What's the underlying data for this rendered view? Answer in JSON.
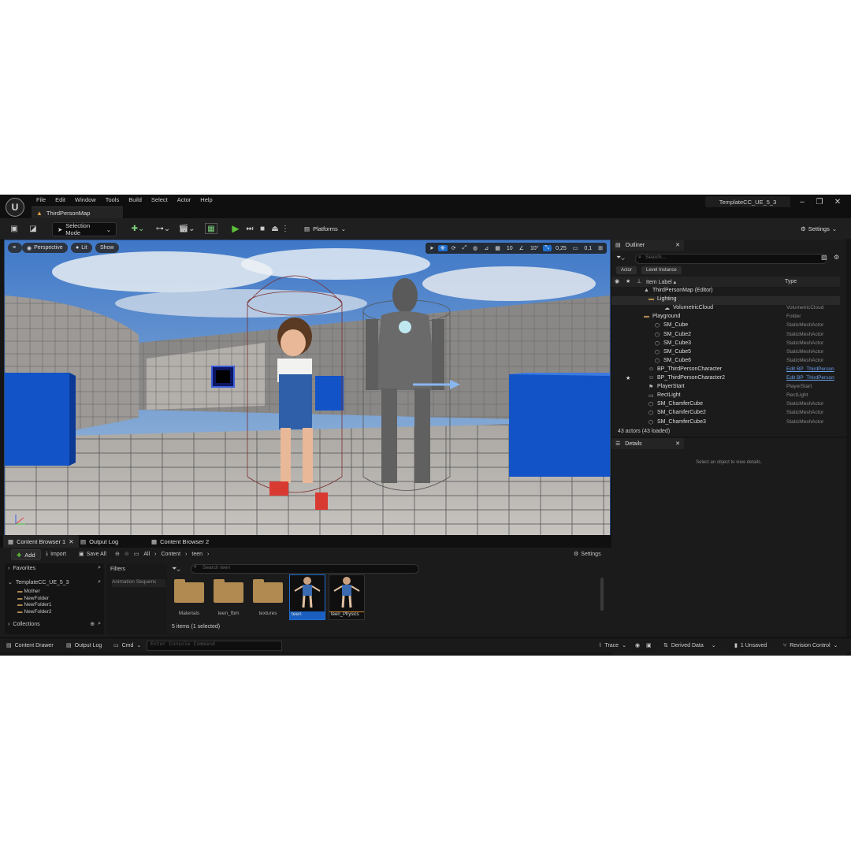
{
  "app": {
    "menus": [
      "File",
      "Edit",
      "Window",
      "Tools",
      "Build",
      "Select",
      "Actor",
      "Help"
    ],
    "map_tab": "ThirdPersonMap",
    "project": "TemplateCC_UE_5_3"
  },
  "toolbar": {
    "selection_mode": "Selection Mode",
    "platforms": "Platforms",
    "settings": "Settings"
  },
  "viewport": {
    "perspective": "Perspective",
    "lit": "Lit",
    "show": "Show",
    "grid_snap": "10",
    "rot_snap": "10°",
    "scale_snap": "0,25",
    "cam_speed": "0,1"
  },
  "outliner": {
    "tab": "Outliner",
    "search_placeholder": "Search...",
    "chips": [
      "Actor",
      "Level Instance"
    ],
    "col_label": "Item Label ▴",
    "col_type": "Type",
    "rows": [
      {
        "label": "ThirdPersonMap (Editor)",
        "type": ""
      },
      {
        "label": "Lighting",
        "type": ""
      },
      {
        "label": "VolumetricCloud",
        "type": "VolumetricCloud"
      },
      {
        "label": "Playground",
        "type": "Folder"
      },
      {
        "label": "SM_Cube",
        "type": "StaticMeshActor"
      },
      {
        "label": "SM_Cube2",
        "type": "StaticMeshActor"
      },
      {
        "label": "SM_Cube3",
        "type": "StaticMeshActor"
      },
      {
        "label": "SM_Cube5",
        "type": "StaticMeshActor"
      },
      {
        "label": "SM_Cube6",
        "type": "StaticMeshActor"
      },
      {
        "label": "BP_ThirdPersonCharacter",
        "type": "Edit BP_ThirdPerson"
      },
      {
        "label": "BP_ThirdPersonCharacter2",
        "type": "Edit BP_ThirdPerson"
      },
      {
        "label": "PlayerStart",
        "type": "PlayerStart"
      },
      {
        "label": "RectLight",
        "type": "RectLight"
      },
      {
        "label": "SM_ChamferCube",
        "type": "StaticMeshActor"
      },
      {
        "label": "SM_ChamferCube2",
        "type": "StaticMeshActor"
      },
      {
        "label": "SM_ChamferCube3",
        "type": "StaticMeshActor"
      }
    ],
    "count": "43 actors (43 loaded)"
  },
  "details": {
    "tab": "Details",
    "empty": "Select an object to view details."
  },
  "content_browser": {
    "tabs": [
      "Content Browser 1",
      "Output Log",
      "Content Browser 2"
    ],
    "add": "Add",
    "import": "Import",
    "save_all": "Save All",
    "path": [
      "All",
      "Content",
      "teen"
    ],
    "settings": "Settings",
    "favorites": "Favorites",
    "project_root": "TemplateCC_UE_5_3",
    "tree": [
      "Mother",
      "NewFolder",
      "NewFolder1",
      "NewFolder2"
    ],
    "collections": "Collections",
    "filters": "Filters",
    "filter_chip": "Animation Sequenc",
    "search_placeholder": "Search teen",
    "items": [
      {
        "name": "Materials",
        "kind": "folder"
      },
      {
        "name": "teen_fbm",
        "kind": "folder"
      },
      {
        "name": "textures",
        "kind": "folder"
      },
      {
        "name": "teen",
        "kind": "asset"
      },
      {
        "name": "teen_Physics",
        "kind": "asset"
      }
    ],
    "status": "5 items (1 selected)"
  },
  "statusbar": {
    "content_drawer": "Content Drawer",
    "output_log": "Output Log",
    "cmd": "Cmd",
    "console_placeholder": "Enter Console Command",
    "trace": "Trace",
    "derived_data": "Derived Data",
    "unsaved": "1 Unsaved",
    "revision": "Revision Control"
  },
  "colors": {
    "accent": "#1f6fd1",
    "play": "#5ec13a",
    "folder": "#b08a50",
    "selected": "#1a5fc0"
  }
}
